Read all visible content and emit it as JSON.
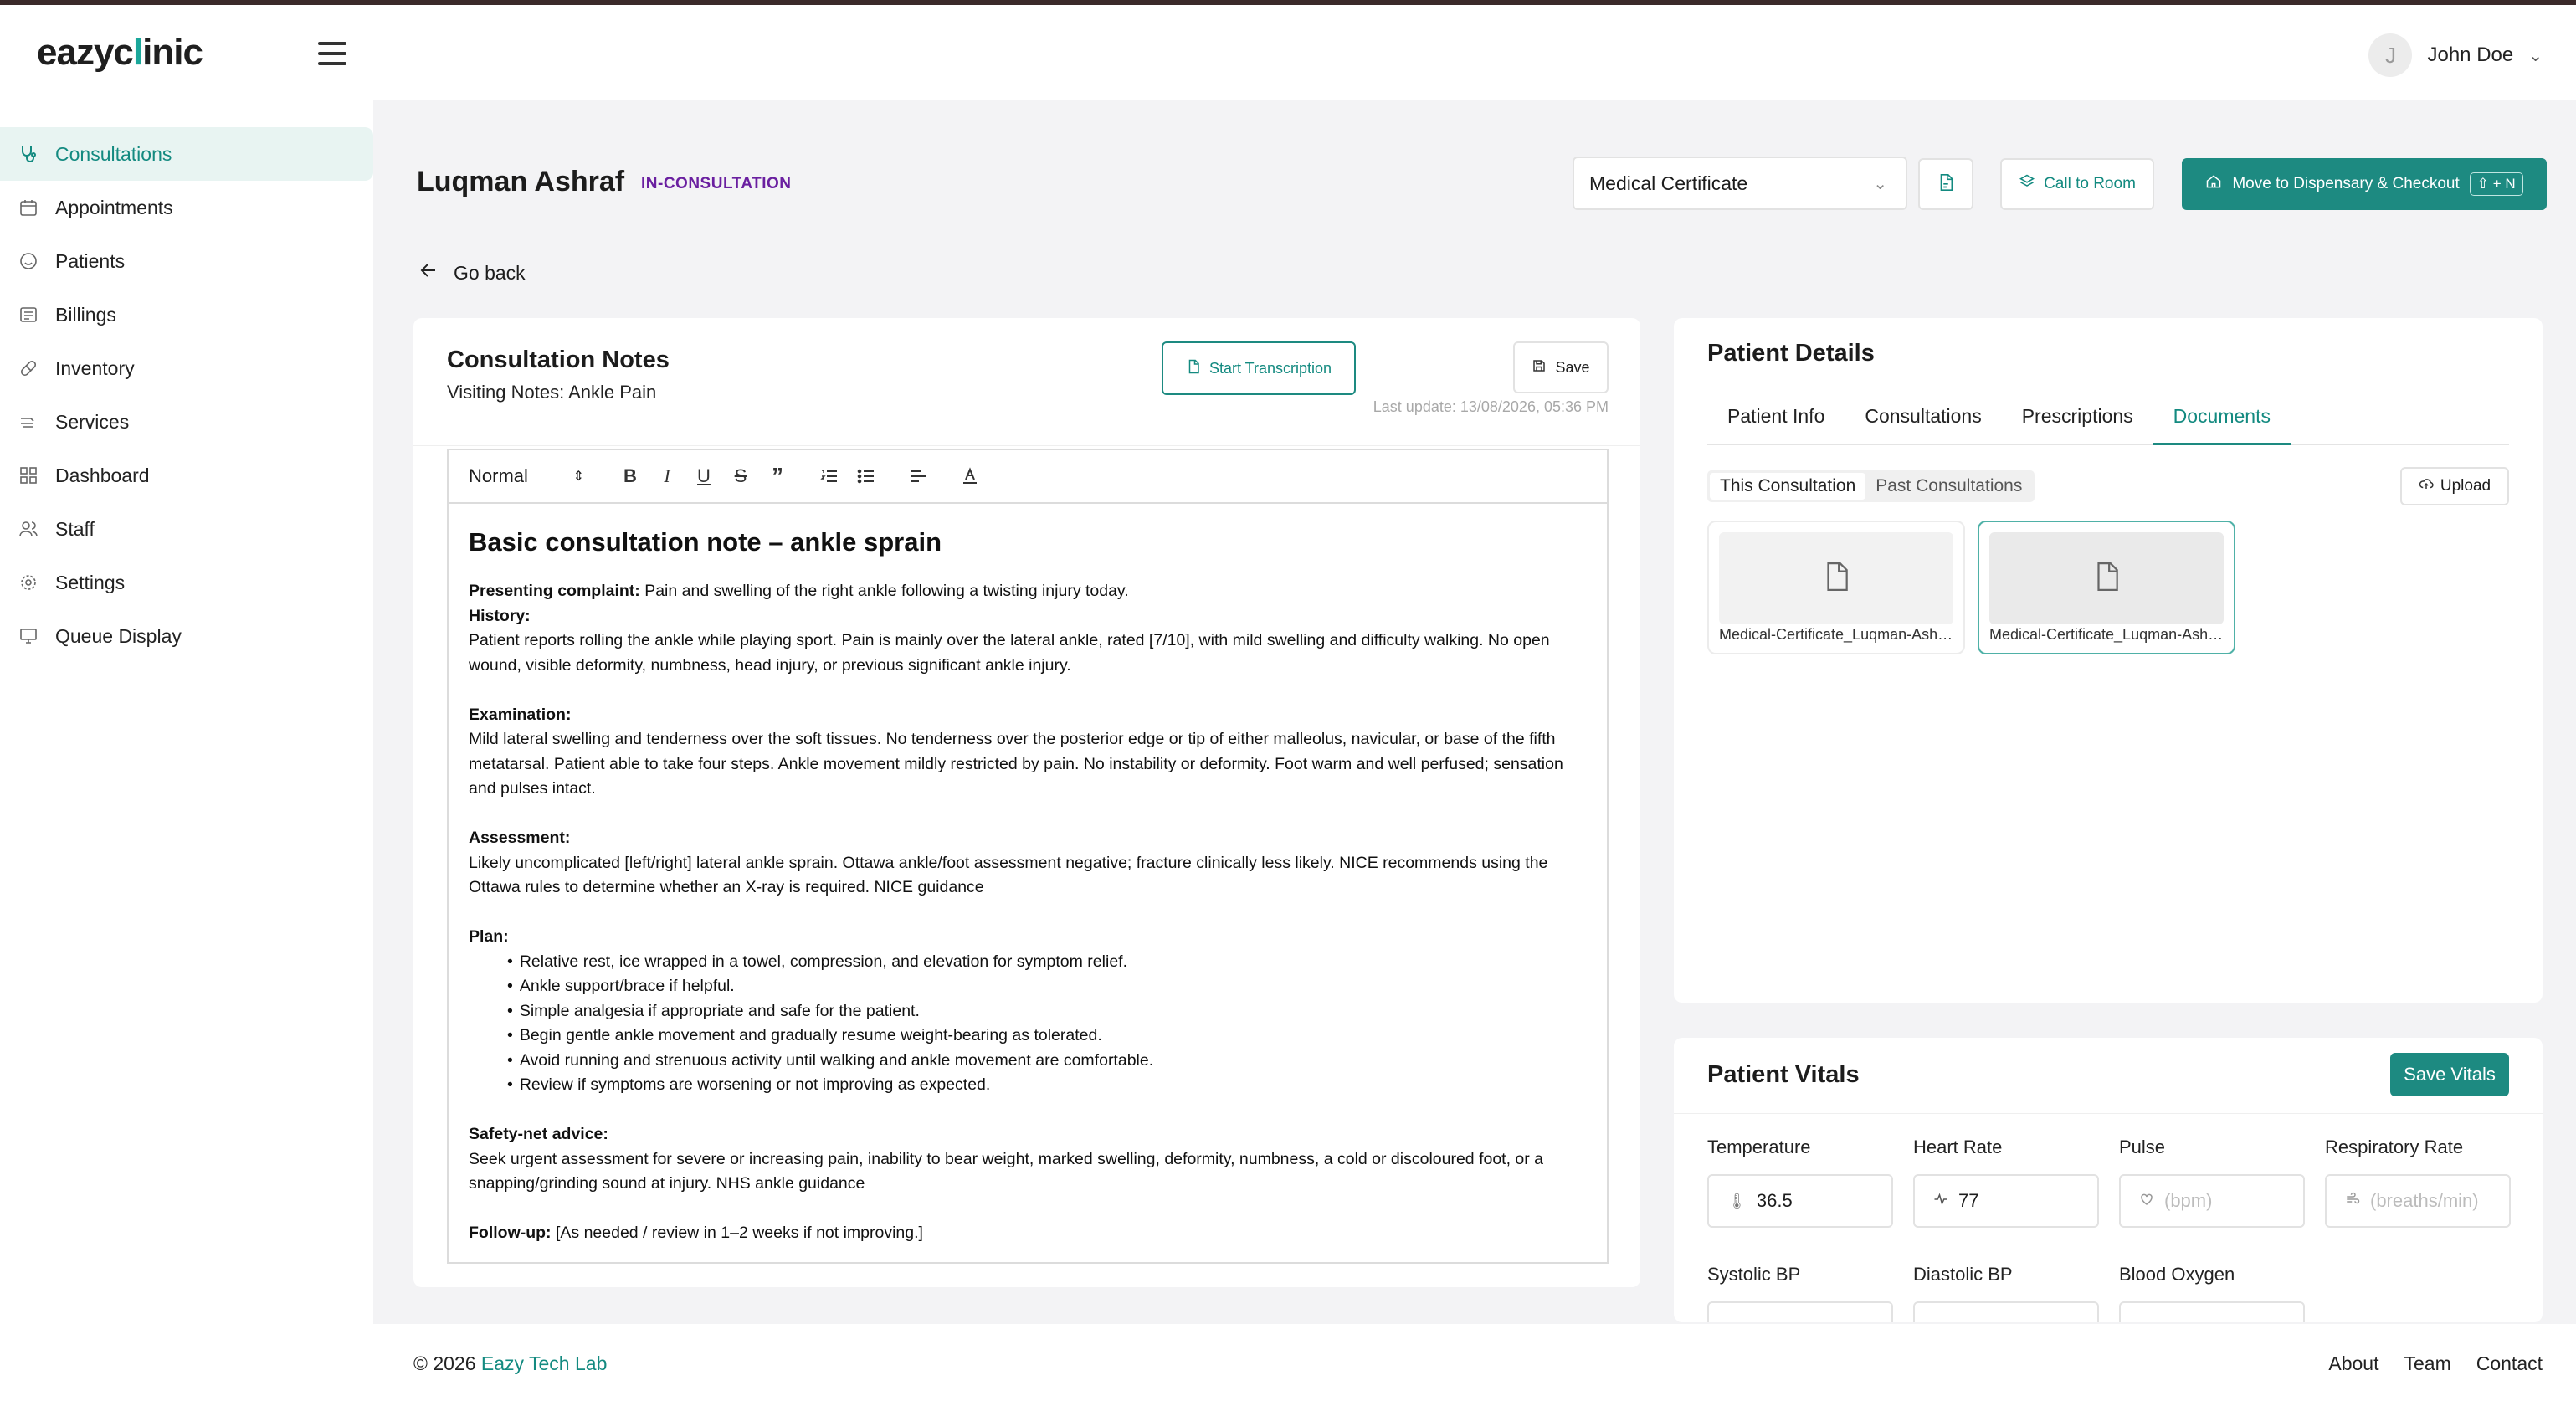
{
  "header": {
    "logo_text_1": "eazyc",
    "logo_text_x": "l",
    "logo_text_2": "inic",
    "user_initial": "J",
    "user_name": "John Doe"
  },
  "sidebar": {
    "items": [
      {
        "label": "Consultations",
        "icon": "stethoscope-icon",
        "active": true
      },
      {
        "label": "Appointments",
        "icon": "calendar-icon",
        "active": false
      },
      {
        "label": "Patients",
        "icon": "smile-icon",
        "active": false
      },
      {
        "label": "Billings",
        "icon": "billing-icon",
        "active": false
      },
      {
        "label": "Inventory",
        "icon": "pill-icon",
        "active": false
      },
      {
        "label": "Services",
        "icon": "services-icon",
        "active": false
      },
      {
        "label": "Dashboard",
        "icon": "dashboard-icon",
        "active": false
      },
      {
        "label": "Staff",
        "icon": "staff-icon",
        "active": false
      },
      {
        "label": "Settings",
        "icon": "gear-icon",
        "active": false
      },
      {
        "label": "Queue Display",
        "icon": "monitor-icon",
        "active": false
      }
    ]
  },
  "patient": {
    "name": "Luqman Ashraf",
    "status": "IN-CONSULTATION"
  },
  "actions": {
    "certificate_select": "Medical Certificate",
    "call_to_room": "Call to Room",
    "move_checkout": "Move to Dispensary & Checkout",
    "move_shortcut": "⇧ + N",
    "go_back": "Go back"
  },
  "notes": {
    "title": "Consultation Notes",
    "subtitle": "Visiting Notes: Ankle Pain",
    "start_transcription": "Start Transcription",
    "save": "Save",
    "last_update": "Last update: 13/08/2026, 05:36 PM",
    "format_select": "Normal",
    "heading": "Basic consultation note – ankle sprain",
    "presenting_label": "Presenting complaint:",
    "presenting_text": " Pain and swelling of the right ankle following a twisting injury today.",
    "history_label": "History:",
    "history_text": "Patient reports rolling the ankle while playing sport. Pain is mainly over the lateral ankle, rated [7/10], with mild swelling and difficulty walking. No open wound, visible deformity, numbness, head injury, or previous significant ankle injury.",
    "exam_label": "Examination:",
    "exam_text": "Mild lateral swelling and tenderness over the soft tissues. No tenderness over the posterior edge or tip of either malleolus, navicular, or base of the fifth metatarsal. Patient able to take four steps. Ankle movement mildly restricted by pain. No instability or deformity. Foot warm and well perfused; sensation and pulses intact.",
    "assessment_label": "Assessment:",
    "assessment_text": "Likely uncomplicated [left/right] lateral ankle sprain. Ottawa ankle/foot assessment negative; fracture clinically less likely. NICE recommends using the Ottawa rules to determine whether an X-ray is required. NICE guidance",
    "plan_label": "Plan:",
    "plan_items": [
      "Relative rest, ice wrapped in a towel, compression, and elevation for symptom relief.",
      "Ankle support/brace if helpful.",
      "Simple analgesia if appropriate and safe for the patient.",
      "Begin gentle ankle movement and gradually resume weight-bearing as tolerated.",
      "Avoid running and strenuous activity until walking and ankle movement are comfortable.",
      "Review if symptoms are worsening or not improving as expected."
    ],
    "safety_label": "Safety-net advice:",
    "safety_text": "Seek urgent assessment for severe or increasing pain, inability to bear weight, marked swelling, deformity, numbness, a cold or discoloured foot, or a snapping/grinding sound at injury. NHS ankle guidance",
    "followup_label": "Follow-up:",
    "followup_text": " [As needed / review in 1–2 weeks if not improving.]"
  },
  "details": {
    "title": "Patient Details",
    "tabs": [
      "Patient Info",
      "Consultations",
      "Prescriptions",
      "Documents"
    ],
    "active_tab": "Documents",
    "segments": [
      "This Consultation",
      "Past Consultations"
    ],
    "upload": "Upload",
    "documents": [
      {
        "name": "Medical-Certificate_Luqman-Ashraf"
      },
      {
        "name": "Medical-Certificate_Luqman-Ashraf"
      }
    ]
  },
  "vitals": {
    "title": "Patient Vitals",
    "save": "Save Vitals",
    "fields": [
      {
        "label": "Temperature",
        "value": "36.5",
        "placeholder": "",
        "icon": "thermometer-icon"
      },
      {
        "label": "Heart Rate",
        "value": "77",
        "placeholder": "",
        "icon": "heartbeat-icon"
      },
      {
        "label": "Pulse",
        "value": "",
        "placeholder": "(bpm)",
        "icon": "heart-icon"
      },
      {
        "label": "Respiratory Rate",
        "value": "",
        "placeholder": "(breaths/min)",
        "icon": "wind-icon"
      },
      {
        "label": "Systolic BP",
        "value": "",
        "placeholder": "",
        "icon": ""
      },
      {
        "label": "Diastolic BP",
        "value": "",
        "placeholder": "",
        "icon": ""
      },
      {
        "label": "Blood Oxygen",
        "value": "",
        "placeholder": "",
        "icon": ""
      }
    ]
  },
  "footer": {
    "copyright": "© 2026 ",
    "brand": "Eazy Tech Lab",
    "links": [
      "About",
      "Team",
      "Contact"
    ]
  },
  "colors": {
    "accent": "#1d8a81",
    "status": "#6a1fa0",
    "active_bg": "#e8f4f2"
  }
}
